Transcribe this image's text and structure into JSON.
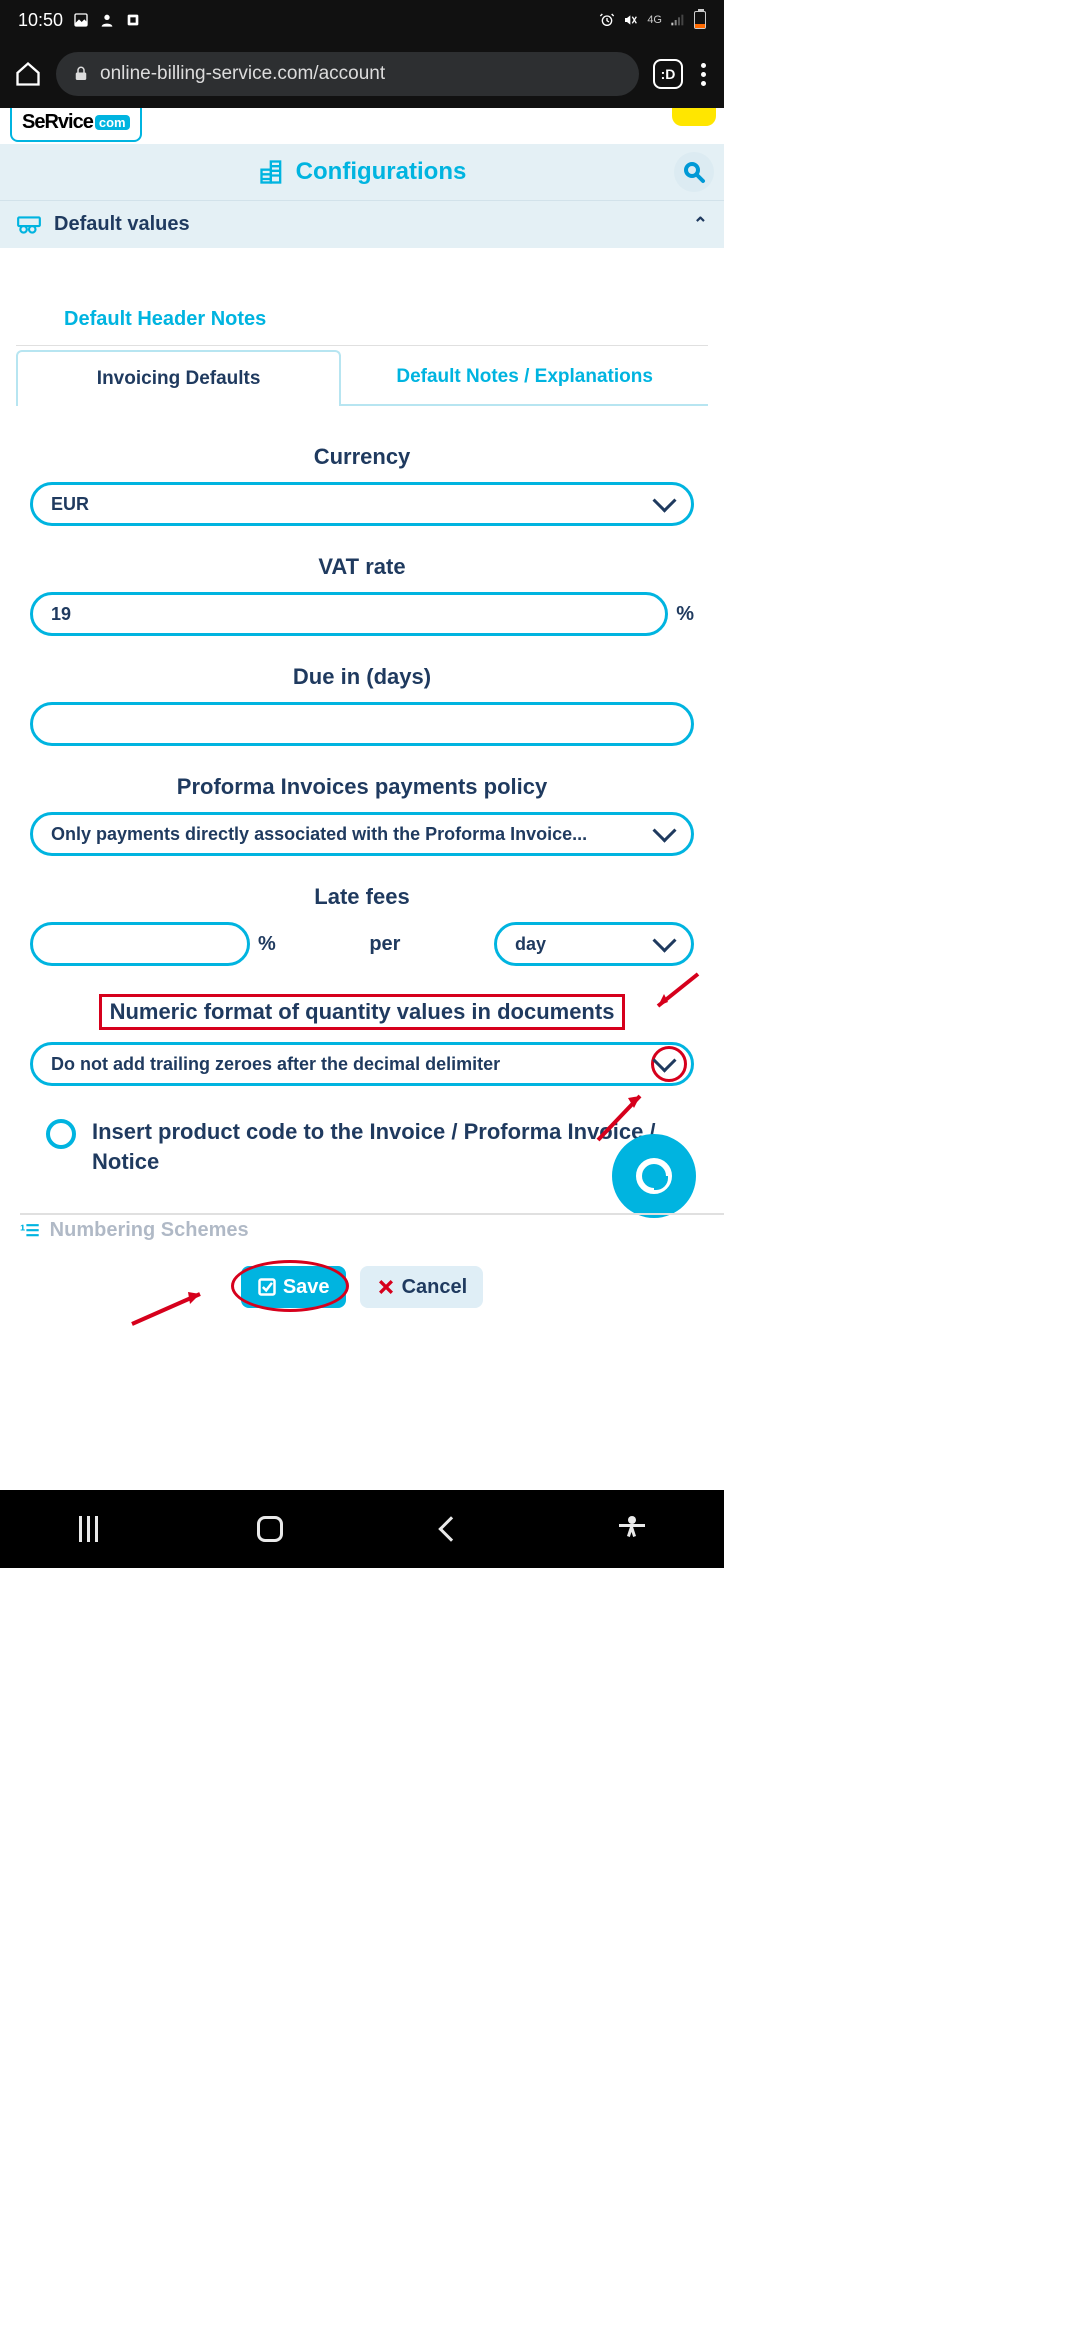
{
  "status": {
    "time": "10:50",
    "network": "4G"
  },
  "browser": {
    "url": "online-billing-service.com/account",
    "tab_indicator": ":D"
  },
  "logo": {
    "text": "SeRvice",
    "badge": "com"
  },
  "header": {
    "title": "Configurations"
  },
  "section_default_values": {
    "title": "Default values"
  },
  "link_header_notes": "Default Header Notes",
  "tabs": {
    "active": "Invoicing Defaults",
    "inactive": "Default Notes / Explanations"
  },
  "form": {
    "currency": {
      "label": "Currency",
      "value": "EUR"
    },
    "vat_rate": {
      "label": "VAT rate",
      "value": "19",
      "unit": "%"
    },
    "due_in": {
      "label": "Due in (days)",
      "value": ""
    },
    "proforma_policy": {
      "label": "Proforma Invoices payments policy",
      "value": "Only payments directly associated with the Proforma Invoice..."
    },
    "late_fees": {
      "label": "Late fees",
      "percent_value": "",
      "percent_unit": "%",
      "per_word": "per",
      "unit_value": "day"
    },
    "numeric_format": {
      "label": "Numeric format of quantity values in documents",
      "value": "Do not add trailing zeroes after the decimal delimiter"
    },
    "insert_code": {
      "label": "Insert product code to the Invoice / Proforma Invoice / Notice",
      "checked": false
    }
  },
  "buttons": {
    "save": "Save",
    "cancel": "Cancel"
  },
  "next_section_hint": "Numbering Schemes"
}
